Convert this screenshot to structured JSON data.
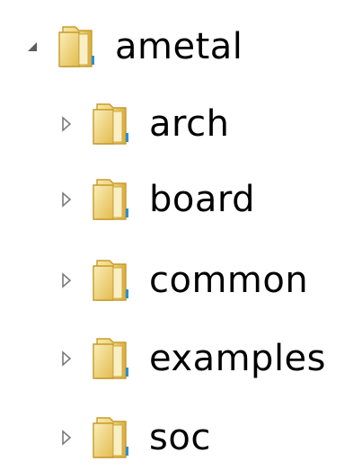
{
  "tree": {
    "root": {
      "label": "ametal",
      "expanded": true,
      "expander_icon": "triangle-expanded-icon",
      "icon": "folder-icon"
    },
    "children": [
      {
        "label": "arch",
        "expanded": false,
        "expander_icon": "triangle-collapsed-icon",
        "icon": "folder-icon"
      },
      {
        "label": "board",
        "expanded": false,
        "expander_icon": "triangle-collapsed-icon",
        "icon": "folder-icon"
      },
      {
        "label": "common",
        "expanded": false,
        "expander_icon": "triangle-collapsed-icon",
        "icon": "folder-icon"
      },
      {
        "label": "examples",
        "expanded": false,
        "expander_icon": "triangle-collapsed-icon",
        "icon": "folder-icon"
      },
      {
        "label": "soc",
        "expanded": false,
        "expander_icon": "triangle-collapsed-icon",
        "icon": "folder-icon"
      }
    ]
  },
  "colors": {
    "folder_light": "#f6e49a",
    "folder_mid": "#e9c75a",
    "folder_dark": "#c99a2a",
    "folder_accent": "#2a8fd0",
    "expander": "#6e6e6e"
  }
}
